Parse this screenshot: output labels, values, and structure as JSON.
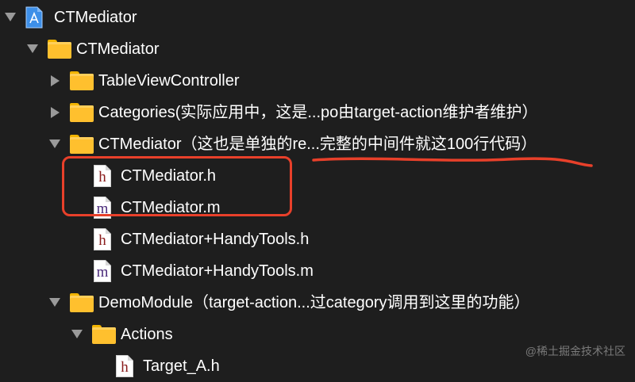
{
  "tree": {
    "project": {
      "label": "CTMediator",
      "icon": "xcode-project-icon"
    },
    "group_root": {
      "label": "CTMediator"
    },
    "group_tableview": {
      "label": "TableViewController"
    },
    "group_categories": {
      "label": "Categories(实际应用中，这是...po由target-action维护者维护）"
    },
    "group_ctmediator": {
      "label": "CTMediator（这也是单独的re...完整的中间件就这100行代码）"
    },
    "files_ctmediator": [
      {
        "label": "CTMediator.h",
        "type": "h"
      },
      {
        "label": "CTMediator.m",
        "type": "m"
      },
      {
        "label": "CTMediator+HandyTools.h",
        "type": "h"
      },
      {
        "label": "CTMediator+HandyTools.m",
        "type": "m"
      }
    ],
    "group_demomodule": {
      "label": "DemoModule（target-action...过category调用到这里的功能）"
    },
    "group_actions": {
      "label": "Actions"
    },
    "files_actions": [
      {
        "label": "Target_A.h",
        "type": "h"
      }
    ]
  },
  "watermark": "@稀土掘金技术社区",
  "colors": {
    "background": "#1e1e1e",
    "folder": "#ffc02e",
    "annotation": "#e8402a"
  }
}
